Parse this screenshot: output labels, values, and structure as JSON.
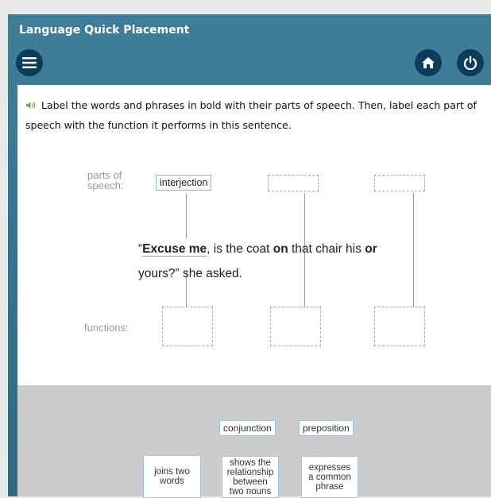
{
  "app": {
    "title": "Language Quick Placement"
  },
  "toolbar": {
    "menu_icon": "hamburger-menu-icon",
    "home_icon": "home-icon",
    "power_icon": "power-icon"
  },
  "instruction": {
    "audio_icon": "speaker-icon",
    "text": "Label the words and phrases in bold with their parts of speech. Then, label each part of speech with the function it performs in this sentence."
  },
  "diagram": {
    "parts_of_speech_label_line1": "parts of",
    "parts_of_speech_label_line2": "speech:",
    "functions_label": "functions:",
    "placed_part_of_speech": "interjection",
    "sentence": {
      "open_quote": "“",
      "bold1": "Excuse me",
      "text1": ", is the coat ",
      "bold2": "on",
      "text2": " that chair his ",
      "bold3": "or",
      "line2": "yours?” she asked."
    }
  },
  "tray": {
    "parts_of_speech": [
      "conjunction",
      "preposition"
    ],
    "functions": [
      [
        "joins two",
        "words"
      ],
      [
        "shows the",
        "relationship",
        "between",
        "two nouns"
      ],
      [
        "expresses",
        "a common",
        "phrase"
      ]
    ]
  },
  "colors": {
    "frame": "#3f7d99",
    "button": "#0b3d5a",
    "tray": "#cccccc",
    "chip_border": "#9ec5e6"
  }
}
